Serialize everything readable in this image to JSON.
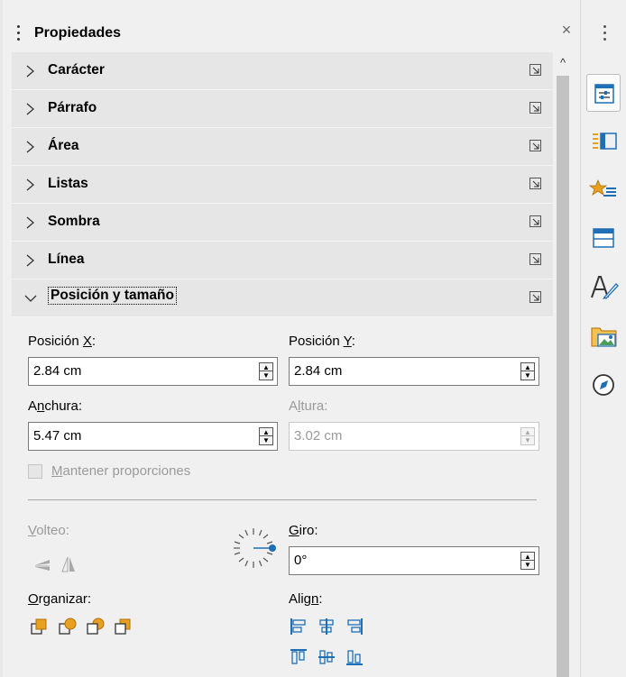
{
  "panel": {
    "title": "Propiedades",
    "close_glyph": "×",
    "scroll_up_glyph": "^"
  },
  "sections": [
    {
      "label": "Carácter",
      "expanded": false
    },
    {
      "label": "Párrafo",
      "expanded": false
    },
    {
      "label": "Área",
      "expanded": false
    },
    {
      "label": "Listas",
      "expanded": false
    },
    {
      "label": "Sombra",
      "expanded": false
    },
    {
      "label": "Línea",
      "expanded": false
    },
    {
      "label": "Posición y tamaño",
      "expanded": true
    }
  ],
  "position_size": {
    "pos_x": {
      "label_pre": "Posición ",
      "label_key": "X",
      "label_post": ":",
      "value": "2.84 cm",
      "enabled": true
    },
    "pos_y": {
      "label_pre": "Posición ",
      "label_key": "Y",
      "label_post": ":",
      "value": "2.84 cm",
      "enabled": true
    },
    "width": {
      "label_pre": "A",
      "label_key": "n",
      "label_post": "chura:",
      "value": "5.47 cm",
      "enabled": true
    },
    "height": {
      "label_pre": "A",
      "label_key": "l",
      "label_post": "tura:",
      "value": "3.02 cm",
      "enabled": false
    },
    "keep_ratio": {
      "label_key": "M",
      "label_post": "antener proporciones",
      "checked": false,
      "enabled": false
    },
    "flip": {
      "label_key": "V",
      "label_post": "olteo:",
      "enabled": false
    },
    "rotation": {
      "label_key": "G",
      "label_post": "iro:",
      "value": "0°"
    },
    "arrange": {
      "label_key": "O",
      "label_post": "rganizar:"
    },
    "align": {
      "label_pre": "Alig",
      "label_key": "n",
      "label_post": ":"
    }
  },
  "sidebar_tabs": [
    {
      "name": "properties-tab-icon",
      "active": true
    },
    {
      "name": "styles-tab-icon",
      "active": false
    },
    {
      "name": "gallery-tab-icon",
      "active": false
    },
    {
      "name": "page-tab-icon",
      "active": false
    },
    {
      "name": "style-inspector-tab-icon",
      "active": false
    },
    {
      "name": "image-gallery-tab-icon",
      "active": false
    },
    {
      "name": "navigator-tab-icon",
      "active": false
    }
  ],
  "colors": {
    "accent_blue": "#1e6fb5",
    "arrange_orange": "#e8a020",
    "section_bg": "#e6e6e6",
    "scroll_thumb": "#c2c2c2"
  }
}
